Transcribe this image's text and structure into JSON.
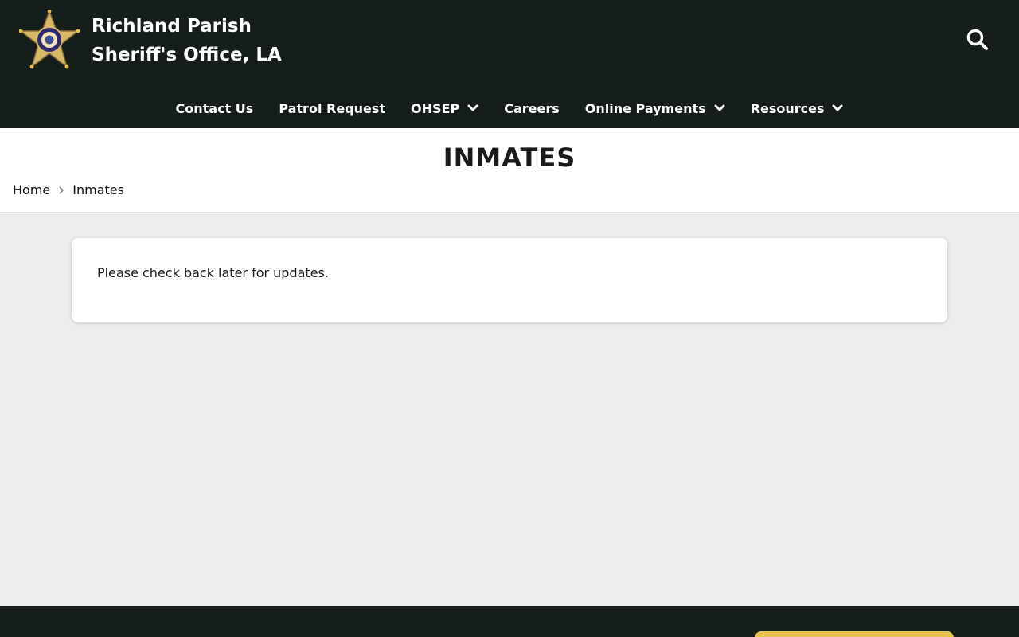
{
  "colors": {
    "header_bg": "#161e1b",
    "page_bg": "#ededed",
    "accent_gold": "#e7c24e",
    "text": "#1a1a1a"
  },
  "header": {
    "title_line1": "Richland Parish",
    "title_line2": "Sheriff's Office, LA",
    "logo_icon": "sheriff-star-badge",
    "search_icon": "search-icon"
  },
  "nav": {
    "items": [
      {
        "label": "Contact Us",
        "has_dropdown": false
      },
      {
        "label": "Patrol Request",
        "has_dropdown": false
      },
      {
        "label": "OHSEP",
        "has_dropdown": true
      },
      {
        "label": "Careers",
        "has_dropdown": false
      },
      {
        "label": "Online Payments",
        "has_dropdown": true
      },
      {
        "label": "Resources",
        "has_dropdown": true
      }
    ]
  },
  "page": {
    "title": "INMATES",
    "breadcrumb": [
      "Home",
      "Inmates"
    ]
  },
  "content": {
    "message": "Please check back later for updates."
  }
}
